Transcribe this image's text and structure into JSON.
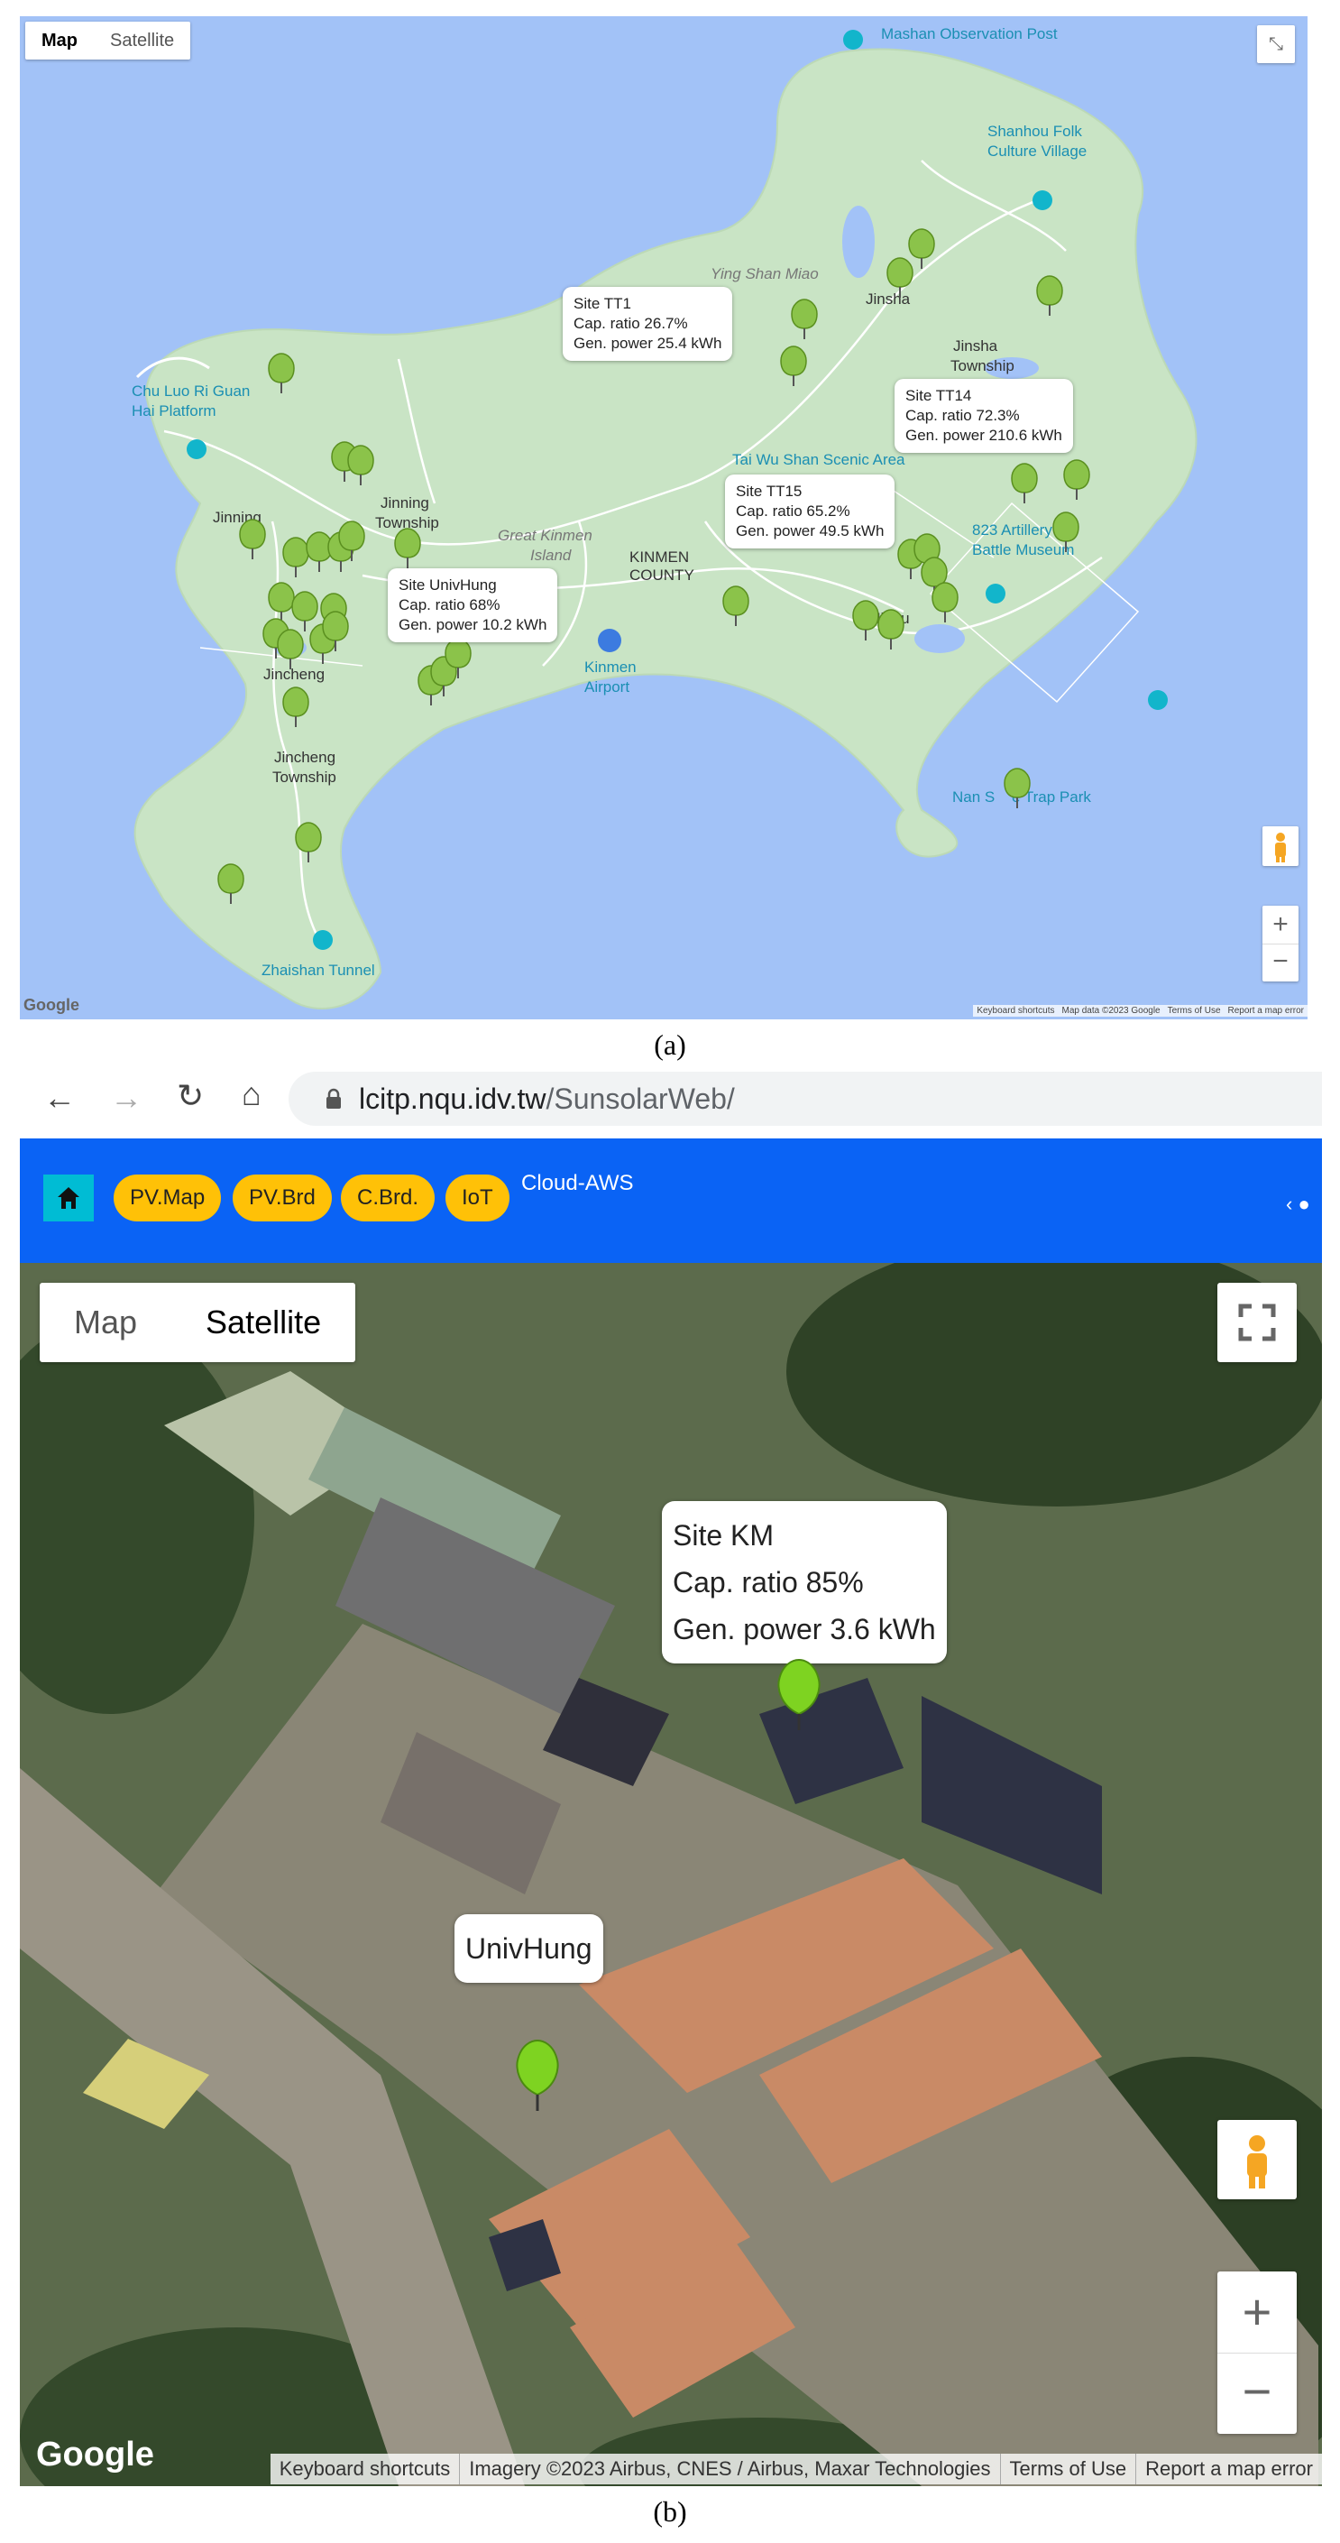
{
  "panel_a": {
    "map_type_control": {
      "map": "Map",
      "satellite": "Satellite"
    },
    "places": {
      "mashan": "Mashan Observation Post",
      "shanhou": "Shanhou Folk",
      "shanhou2": "Culture Village",
      "ying_shan": "Ying Shan Miao",
      "jinsha": "Jinsha",
      "jinsha_township": "Jinsha",
      "jinsha_township2": "Township",
      "chu_luo": "Chu Luo Ri Guan",
      "chu_luo2": "Hai Platform",
      "taiwushan": "Tai Wu Shan Scenic Area",
      "artillery": "823 Artillery",
      "artillery2": "Battle Museum",
      "jinning": "Jinning",
      "jinning_township": "Jinning",
      "jinning_township2": "Township",
      "great_kinmen": "Great Kinmen",
      "great_kinmen2": "Island",
      "kinmen_county": "KINMEN",
      "kinmen_county2": "COUNTY",
      "jinhu": "Jinhu",
      "jincheng": "Jincheng",
      "kinmen_airport": "Kinmen",
      "kinmen_airport2": "Airport",
      "nanshan": "Nan S",
      "nanshan2": "e Trap Park",
      "jincheng_township": "Jincheng",
      "jincheng_township2": "Township",
      "zhaishan": "Zhaishan Tunnel"
    },
    "info_windows": [
      {
        "l1": "Site TT1",
        "l2": "Cap. ratio 26.7%",
        "l3": "Gen. power 25.4 kWh"
      },
      {
        "l1": "Site TT14",
        "l2": "Cap. ratio 72.3%",
        "l3": "Gen. power 210.6 kWh"
      },
      {
        "l1": "Site TT15",
        "l2": "Cap. ratio 65.2%",
        "l3": "Gen. power 49.5 kWh"
      },
      {
        "l1": "Site UnivHung",
        "l2": "Cap. ratio 68%",
        "l3": "Gen. power 10.2 kWh"
      }
    ],
    "google_logo": "Google",
    "footer": {
      "shortcuts": "Keyboard shortcuts",
      "data": "Map data ©2023 Google",
      "terms": "Terms of Use",
      "report": "Report a map error"
    },
    "zoom_in": "+",
    "zoom_out": "−",
    "caption": "(a)"
  },
  "panel_b": {
    "browser": {
      "url_host": "lcitp.nqu.idv.tw",
      "url_path": "/SunsolarWeb/"
    },
    "nav": {
      "items": [
        "PV.Map",
        "PV.Brd",
        "C.Brd.",
        "IoT"
      ],
      "cloud": "Cloud-AWS"
    },
    "map_type_control": {
      "map": "Map",
      "satellite": "Satellite"
    },
    "info_km": {
      "l1": "Site KM",
      "l2": "Cap. ratio 85%",
      "l3": "Gen. power 3.6 kWh"
    },
    "info_univ": {
      "l1": "UnivHung"
    },
    "google_logo": "Google",
    "footer": {
      "shortcuts": "Keyboard shortcuts",
      "imagery": "Imagery ©2023 Airbus, CNES / Airbus, Maxar Technologies",
      "terms": "Terms of Use",
      "report": "Report a map error"
    },
    "zoom_in": "+",
    "zoom_out": "−",
    "caption": "(b)"
  },
  "colors": {
    "nav_blue": "#0a63f5",
    "pill_yellow": "#ffc107",
    "marker_green": "#7ed321",
    "water": "#a2c2f7",
    "land": "#c9e4c5"
  }
}
